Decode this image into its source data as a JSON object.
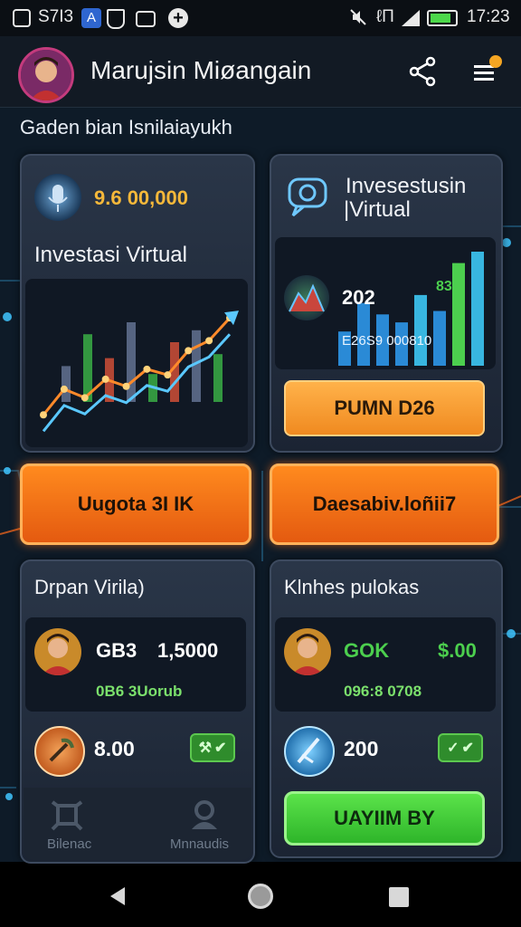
{
  "status_bar": {
    "left_text": "S7I3",
    "time": "17:23",
    "right_text": "ℓΠ",
    "icons": [
      "screenshot-icon",
      "a-app-icon",
      "shield-icon",
      "image-icon",
      "add-circle-icon",
      "mute-icon",
      "signal-icon",
      "battery-icon"
    ]
  },
  "header": {
    "title": "Marujsin Miøangain",
    "icons": [
      "avatar",
      "share-icon",
      "menu-notification-icon"
    ]
  },
  "subtitle": "Gaden bian Isnilaiayukh",
  "cards": {
    "top_left": {
      "amount": "9.6 00,000",
      "title": "Investasi Virtual",
      "icon": "microphone-icon"
    },
    "top_right": {
      "title_line1": "Invesestusin",
      "title_line2": "|Virtual",
      "number": "202",
      "small_value": "83",
      "sub_value": "E26S9 000810",
      "button": "PUMN D26",
      "icon": "chat-bot-icon"
    }
  },
  "buttons": {
    "left": "Uugota 3I IK",
    "right": "Daesabiv.loñii7"
  },
  "lower_cards": {
    "left": {
      "title": "Drpan Virila)",
      "row1_a": "GB3",
      "row1_b": "1,5000",
      "row2": "0B6 3Uorub",
      "row3_value": "8.00",
      "tab1": "Bilenac",
      "tab2": "Mnnaudis"
    },
    "right": {
      "title": "Klnhes pulokas",
      "row1_a": "GOK",
      "row1_b": "$.00",
      "row2": "096:8 0708",
      "row3_value": "200",
      "button": "UAYIIM BY"
    }
  },
  "chart_data": [
    {
      "type": "line",
      "panel": "top_left",
      "series": [
        {
          "values": [
            10,
            28,
            22,
            35,
            30,
            42,
            38,
            55,
            62,
            78
          ]
        }
      ],
      "bars": [
        18,
        34,
        22,
        40,
        14,
        30,
        36,
        24
      ],
      "grid": false
    },
    {
      "type": "bar",
      "panel": "top_right",
      "values": [
        30,
        55,
        45,
        38,
        62,
        48,
        90,
        100
      ],
      "colors": [
        "#2a8ad6",
        "#2a8ad6",
        "#2a8ad6",
        "#2a8ad6",
        "#38b6e0",
        "#2a8ad6",
        "#4ccf4e",
        "#38b6e0"
      ]
    }
  ],
  "colors": {
    "accent_orange": "#ff7a1a",
    "accent_green": "#3ad23a",
    "accent_gold": "#f5b83a",
    "card_bg": "#222d3d"
  }
}
